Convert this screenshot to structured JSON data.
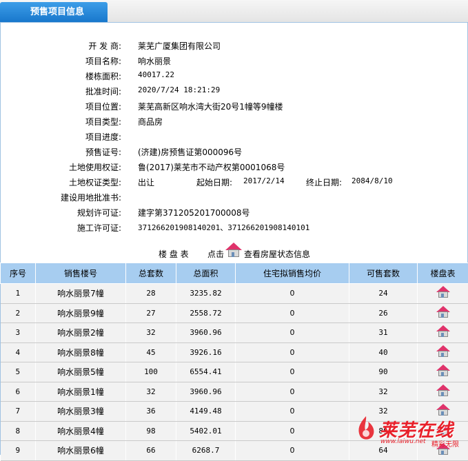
{
  "header": {
    "tab_title": "预售项目信息"
  },
  "project": {
    "fields": [
      {
        "label": "开 发 商:",
        "value": "莱芜广厦集团有限公司"
      },
      {
        "label": "项目名称:",
        "value": "响水丽景"
      },
      {
        "label": "楼栋面积:",
        "value": "40017.22"
      },
      {
        "label": "批准时间:",
        "value": "2020/7/24 18:21:29"
      },
      {
        "label": "项目位置:",
        "value": "莱芜高新区响水湾大街20号1幢等9幢楼"
      },
      {
        "label": "项目类型:",
        "value": "商品房"
      },
      {
        "label": "项目进度:",
        "value": ""
      },
      {
        "label": "预售证号:",
        "value": "(济建)房预售证第000096号"
      },
      {
        "label": "土地使用权证:",
        "value": "鲁(2017)莱芜市不动产权第0001068号"
      },
      {
        "label": "土地权证类型:",
        "value": "出让"
      },
      {
        "label": "建设用地批准书:",
        "value": ""
      },
      {
        "label": "规划许可证:",
        "value": "建字第371205201700008号"
      },
      {
        "label": "施工许可证:",
        "value": "371266201908140201、371266201908140101"
      }
    ],
    "land_start_label": "起始日期:",
    "land_start_value": "2017/2/14",
    "land_end_label": "终止日期:",
    "land_end_value": "2084/8/10"
  },
  "caption": {
    "part1": "楼 盘 表",
    "part2": "点击",
    "part3": "查看房屋状态信息"
  },
  "table": {
    "headers": [
      "序号",
      "销售楼号",
      "总套数",
      "总面积",
      "住宅拟销售均价",
      "可售套数",
      "楼盘表"
    ],
    "rows": [
      [
        "1",
        "响水丽景7幢",
        "28",
        "3235.82",
        "0",
        "24"
      ],
      [
        "2",
        "响水丽景9幢",
        "27",
        "2558.72",
        "0",
        "26"
      ],
      [
        "3",
        "响水丽景2幢",
        "32",
        "3960.96",
        "0",
        "31"
      ],
      [
        "4",
        "响水丽景8幢",
        "45",
        "3926.16",
        "0",
        "40"
      ],
      [
        "5",
        "响水丽景5幢",
        "100",
        "6554.41",
        "0",
        "90"
      ],
      [
        "6",
        "响水丽景1幢",
        "32",
        "3960.96",
        "0",
        "32"
      ],
      [
        "7",
        "响水丽景3幢",
        "36",
        "4149.48",
        "0",
        "32"
      ],
      [
        "8",
        "响水丽景4幢",
        "98",
        "5402.01",
        "0",
        "88"
      ],
      [
        "9",
        "响水丽景6幢",
        "66",
        "6268.7",
        "0",
        "64"
      ]
    ]
  },
  "watermark": {
    "brand": "莱芜在线",
    "url": "www.laiwu.net",
    "slogan": "精彩无限"
  },
  "colors": {
    "tab_blue": "#1f82d6",
    "header_blue": "#a7cdf0",
    "brand_red": "#e8202a"
  },
  "icons": {
    "building_table": "house-icon"
  }
}
